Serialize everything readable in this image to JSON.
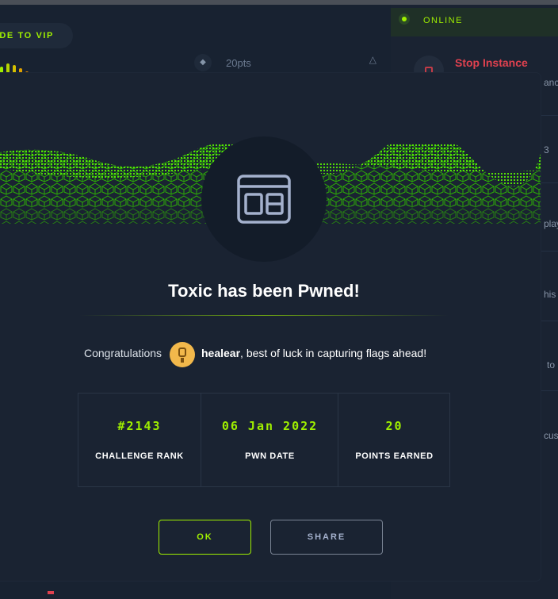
{
  "background": {
    "vip_button_label": "DE TO VIP",
    "points_value": "20pts",
    "status_label": "ONLINE",
    "stop_label": "Stop Instance",
    "right_snippets": [
      "ance",
      "3",
      "play",
      "his c",
      "to",
      "cus"
    ]
  },
  "modal": {
    "title": "Toxic has been Pwned!",
    "congrats_prefix": "Congratulations",
    "username": "healear",
    "congrats_suffix": ", best of luck in capturing flags ahead!",
    "stats": [
      {
        "value": "#2143",
        "label": "CHALLENGE RANK"
      },
      {
        "value": "06 Jan 2022",
        "label": "PWN DATE"
      },
      {
        "value": "20",
        "label": "POINTS EARNED"
      }
    ],
    "ok_label": "OK",
    "share_label": "SHARE"
  },
  "colors": {
    "accent": "#9fef00",
    "danger": "#e0414f",
    "panel": "#1a2332",
    "background": "#141d2b"
  },
  "icons": {
    "emblem": "web-window-icon",
    "status": "online-dot-icon",
    "stop": "stop-icon",
    "points": "diamond-icon"
  }
}
